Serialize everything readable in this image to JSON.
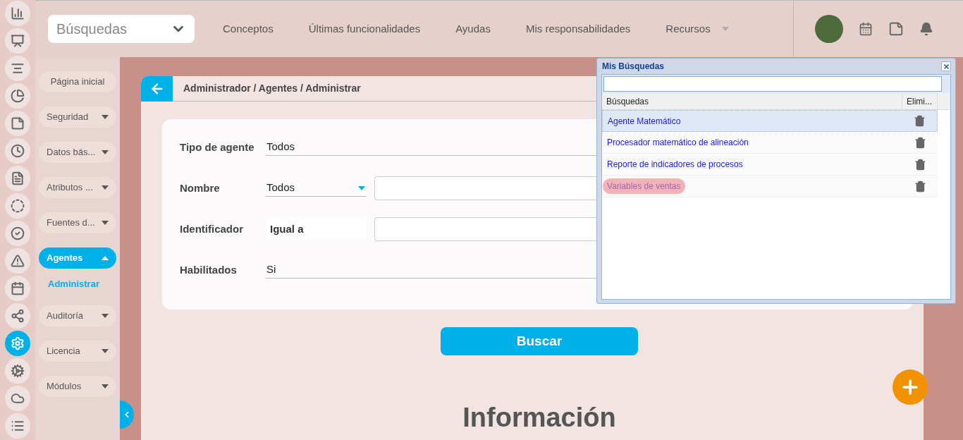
{
  "rail": [
    {
      "kind": "chart",
      "selected": false
    },
    {
      "kind": "presentation",
      "selected": false
    },
    {
      "kind": "align",
      "selected": false
    },
    {
      "kind": "pie",
      "selected": false
    },
    {
      "kind": "note",
      "selected": false
    },
    {
      "kind": "clock",
      "selected": false
    },
    {
      "kind": "document",
      "selected": false
    },
    {
      "kind": "cycle",
      "selected": false
    },
    {
      "kind": "check",
      "selected": false
    },
    {
      "kind": "warning",
      "selected": false
    },
    {
      "kind": "calendar",
      "selected": false
    },
    {
      "kind": "network",
      "selected": false
    },
    {
      "kind": "settings",
      "selected": true
    },
    {
      "kind": "gears",
      "selected": false
    },
    {
      "kind": "cloud",
      "selected": false
    },
    {
      "kind": "list",
      "selected": false
    }
  ],
  "topbar": {
    "search_select": "Búsquedas",
    "nav": [
      {
        "label": "Conceptos",
        "has_menu": false
      },
      {
        "label": "Últimas funcionalidades",
        "has_menu": false
      },
      {
        "label": "Ayudas",
        "has_menu": false
      },
      {
        "label": "Mis responsabilidades",
        "has_menu": false
      },
      {
        "label": "Recursos",
        "has_menu": true
      }
    ]
  },
  "sidebar": {
    "items": [
      {
        "label": "Página inicial",
        "kind": "link",
        "selected": false
      },
      {
        "label": "Seguridad",
        "kind": "menu",
        "expanded": false,
        "selected": false
      },
      {
        "label": "Datos bás...",
        "kind": "menu",
        "expanded": false,
        "selected": false
      },
      {
        "label": "Atributos ...",
        "kind": "menu",
        "expanded": false,
        "selected": false
      },
      {
        "label": "Fuentes d...",
        "kind": "menu",
        "expanded": false,
        "selected": false
      },
      {
        "label": "Agentes",
        "kind": "menu",
        "expanded": true,
        "selected": true,
        "children": [
          {
            "label": "Administrar",
            "selected": true
          }
        ]
      },
      {
        "label": "Auditoría",
        "kind": "menu",
        "expanded": false,
        "selected": false
      },
      {
        "label": "Licencia",
        "kind": "menu",
        "expanded": false,
        "selected": false
      },
      {
        "label": "Módulos",
        "kind": "menu",
        "expanded": false,
        "selected": false
      }
    ]
  },
  "breadcrumb": "Administrador / Agentes / Administrar",
  "form": {
    "fields": [
      {
        "label": "Tipo de agente",
        "kind": "select",
        "value": "Todos"
      },
      {
        "label": "Nombre",
        "kind": "select_input",
        "value": "Todos"
      },
      {
        "label": "Identificador",
        "kind": "fixed_input",
        "value": "Igual a"
      },
      {
        "label": "Habilitados",
        "kind": "select",
        "value": "Si"
      }
    ]
  },
  "search_button": "Buscar",
  "section_title": "Información",
  "popup": {
    "title": "Mis Búsquedas",
    "columns": [
      "Búsquedas",
      "Elimi..."
    ],
    "rows": [
      {
        "label": "Agente Matemático",
        "selected": true,
        "highlighted": false
      },
      {
        "label": "Procesador matemático de alineación",
        "selected": false,
        "highlighted": false
      },
      {
        "label": "Reporte de indicadores de procesos",
        "selected": false,
        "highlighted": false
      },
      {
        "label": "Variables de ventas",
        "selected": false,
        "highlighted": true
      }
    ]
  }
}
